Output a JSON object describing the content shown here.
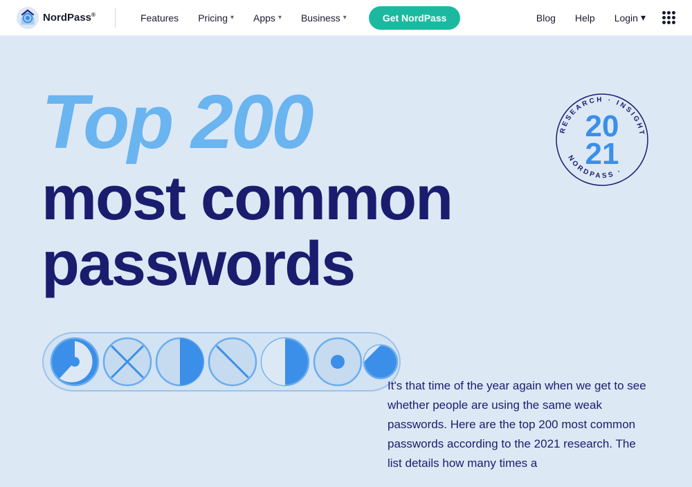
{
  "nav": {
    "logo_text": "NordPass",
    "logo_sup": "®",
    "links": [
      {
        "label": "Features",
        "has_dropdown": false
      },
      {
        "label": "Pricing",
        "has_dropdown": true
      },
      {
        "label": "Apps",
        "has_dropdown": true
      },
      {
        "label": "Business",
        "has_dropdown": true
      }
    ],
    "cta_label": "Get NordPass",
    "right_links": [
      {
        "label": "Blog",
        "has_dropdown": false
      },
      {
        "label": "Help",
        "has_dropdown": false
      },
      {
        "label": "Login",
        "has_dropdown": true
      }
    ]
  },
  "hero": {
    "title_top": "Top 200",
    "title_bottom_line1": "most common",
    "title_bottom_line2": "passwords"
  },
  "badge": {
    "year": "20\n21",
    "ring_text": "RESEARCH · INSIGHTS · NORDPASS ·"
  },
  "description": {
    "text": "It's that time of the year again when we get to see whether people are using the same weak passwords. Here are the top 200 most common passwords according to the 2021 research. The list details how many times a"
  }
}
